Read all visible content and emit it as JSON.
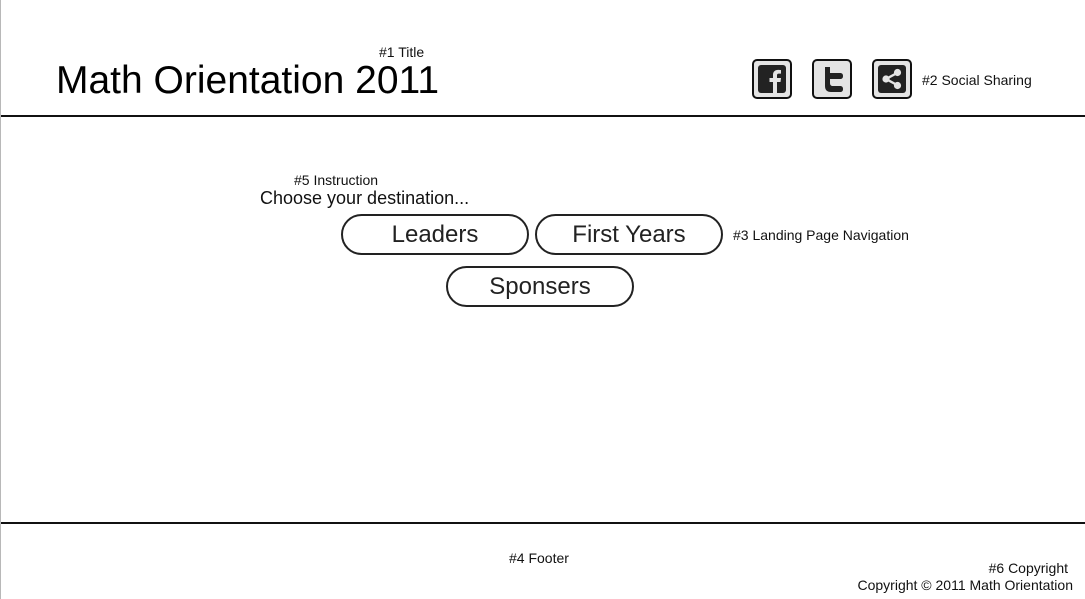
{
  "header": {
    "title": "Math Orientation 2011",
    "title_annotation": "#1 Title",
    "social_annotation": "#2 Social Sharing",
    "social_icons": [
      "facebook-icon",
      "twitter-icon",
      "share-icon"
    ]
  },
  "main": {
    "instruction_annotation": "#5 Instruction",
    "instruction": "Choose your destination...",
    "nav_annotation": "#3 Landing Page Navigation",
    "nav_buttons": [
      "Leaders",
      "First Years",
      "Sponsers"
    ]
  },
  "footer": {
    "footer_annotation": "#4 Footer",
    "copyright_annotation": "#6 Copyright",
    "copyright": "Copyright © 2011 Math Orientation"
  },
  "colors": {
    "line": "#111111",
    "icon_bg": "#e4e4e4"
  }
}
